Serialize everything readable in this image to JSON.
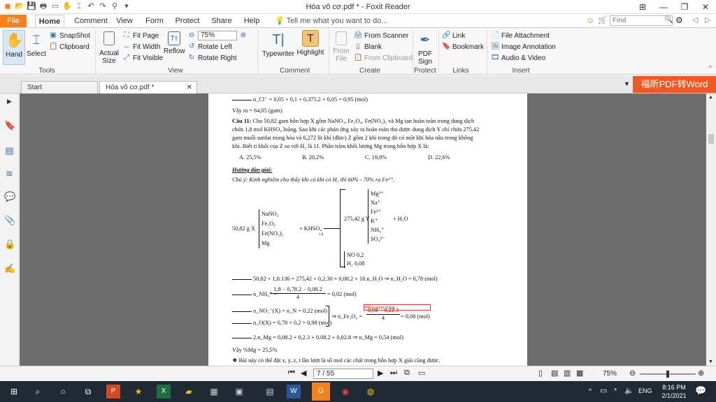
{
  "window": {
    "title": "Hóa vô cơ.pdf * - Foxit Reader"
  },
  "menu_tabs": [
    "File",
    "Home",
    "Comment",
    "View",
    "Form",
    "Protect",
    "Share",
    "Help"
  ],
  "tell_me": "Tell me what you want to do...",
  "find_placeholder": "Find",
  "ribbon": {
    "hand": "Hand",
    "select": "Select",
    "snapshot": "SnapShot",
    "clipboard": "Clipboard",
    "actual_size": "Actual Size",
    "fit_page": "Fit Page",
    "fit_width": "Fit Width",
    "fit_visible": "Fit Visible",
    "reflow": "Reflow",
    "zoom": "75%",
    "rotate_left": "Rotate Left",
    "rotate_right": "Rotate Right",
    "typewriter": "Typewriter",
    "highlight": "Highlight",
    "from_file": "From File",
    "from_scanner": "From Scanner",
    "blank": "Blank",
    "from_clipboard": "From Clipboard",
    "pdf_sign": "PDF Sign",
    "link": "Link",
    "bookmark": "Bookmark",
    "file_attachment": "File Attachment",
    "image_annotation": "Image Annotation",
    "audio_video": "Audio & Video",
    "groups": [
      "Tools",
      "View",
      "Comment",
      "Create",
      "Protect",
      "Links",
      "Insert"
    ]
  },
  "doc_tabs": [
    "Start",
    "Hóa vô cơ.pdf *"
  ],
  "banner": "福昕PDF转Word",
  "doc": {
    "l1": "n_Cl⁻ = 0,05 + 0,1 + 0,375.2 + 0,05 = 0,95 (mol)",
    "l2": "Vậy m = 64,05 (gam)",
    "q_label": "Câu 11:",
    "q_text1": " Cho 50,82 gam hỗn hợp X gồm NaNO₃, Fe₃O₄, Fe(NO₃)₂ và Mg tan hoàn toàn trong dung dịch",
    "q_text2": "chứa 1,8 mol KHSO₄ loãng. Sau khi các phản ứng xảy ra hoàn toàn thu được dung dịch Y chỉ chứa 275,42",
    "q_text3": "gam muối sunfat trung hòa và 6,272 lít khí (đktc) Z gồm 2 khí trong đó có một khí hóa nâu trong không",
    "q_text4": "khí. Biết tỉ khối của Z so với H₂ là 11. Phần trăm khối lượng Mg trong hỗn hợp X là:",
    "opt_a": "A. 25,5%",
    "opt_b": "B. 20,2%",
    "opt_c": "C. 19,8%",
    "opt_d": "D. 22,6%",
    "guide": "Hướng dẫn giải:",
    "note": "Chú ý: Kinh nghiệm cho thấy khi có khí có H₂ thì 60% - 70% ra Fe²⁺.",
    "x_mass": "50,82 g X",
    "x_items": [
      "NaNO₃",
      "Fe₃O₄",
      "Fe(NO₃)₂",
      "Mg"
    ],
    "reagent": "+ KHSO₄",
    "reagent_sub": "1,8",
    "y_mass": "275,42 g Y",
    "y_items": [
      "Mg²⁺",
      "Na⁺",
      "Fe²⁺",
      "K⁺",
      "NH₄⁺",
      "SO₄²⁻"
    ],
    "water": "+ H₂O",
    "gas_items": [
      "NO 0,2",
      "H₂ 0,08"
    ],
    "eq1": "50,82 + 1,8.136 = 275,42 + 0,2.30 + 0,08.2 + 18.n_H₂O ⇒ n_H₂O = 0,78 (mol)",
    "eq2_left": "n_NH₄⁺ =",
    "eq2_num": "1,8 − 0,78.2 − 0,08.2",
    "eq2_den": "4",
    "eq2_right": "= 0,02 (mol)",
    "eq3": "n_NO₃⁻(X) = n_N = 0,22 (mol)",
    "eq4": "n_O(X) = 0,78 + 0,2 = 0,98 (mol)",
    "eq5_left": "⇒ n_Fe₃O₄ =",
    "eq5_num": "0,98 − 0,22.3",
    "eq5_den": "4",
    "eq5_right": "= 0,08 (mol)",
    "annotation": "Phần quan trọng",
    "eq6": "2.n_Mg = 0,08.2 + 0,2.3 + 0,08.2 + 0,02.8 ⇒ n_Mg = 0,54 (mol)",
    "eq7": "Vậy %Mg = 25,5%",
    "eq8": "❖ Bài này có thể đặt x, y, z, t lần lượt là số mol các chất trong hỗn hợp X giải cũng được."
  },
  "status": {
    "page": "7 / 55",
    "zoom": "75%"
  },
  "taskbar": {
    "lang": "ENG",
    "time": "8:16 PM",
    "date": "2/1/2021"
  }
}
